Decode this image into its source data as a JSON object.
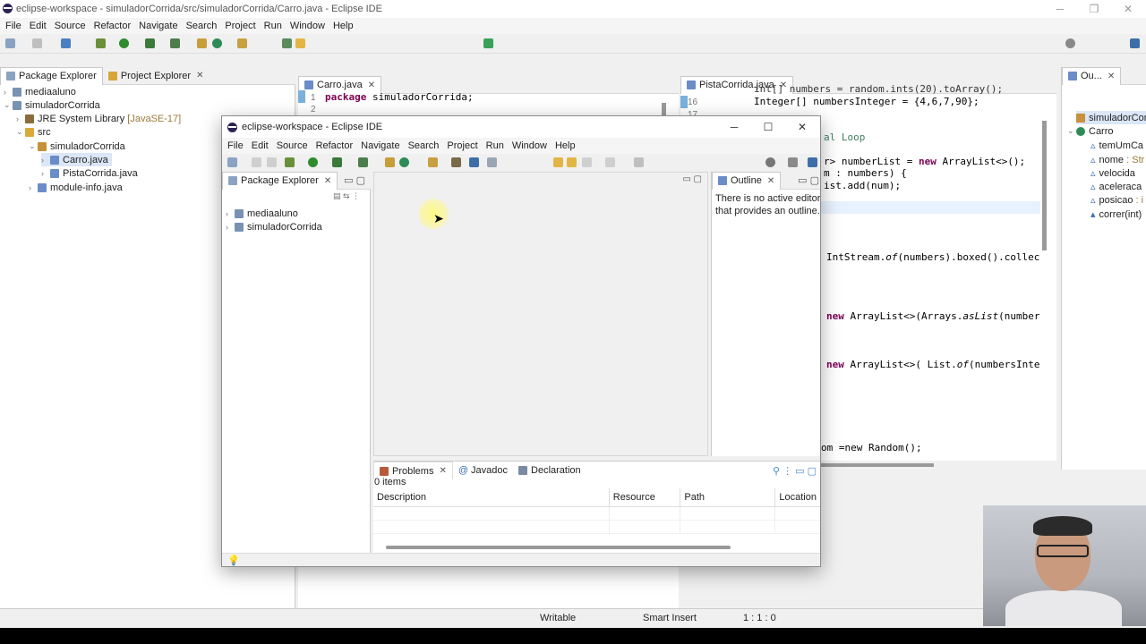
{
  "bg": {
    "title": "eclipse-workspace - simuladorCorrida/src/simuladorCorrida/Carro.java - Eclipse IDE",
    "menu": [
      "File",
      "Edit",
      "Source",
      "Refactor",
      "Navigate",
      "Search",
      "Project",
      "Run",
      "Window",
      "Help"
    ],
    "left_tabs": {
      "pkg": "Package Explorer",
      "proj": "Project Explorer"
    },
    "tree": {
      "r1": "mediaaluno",
      "r2": "simuladorCorrida",
      "r3": "JRE System Library",
      "r3b": "[JavaSE-17]",
      "r4": "src",
      "r5": "simuladorCorrida",
      "r6": "Carro.java",
      "r7": "PistaCorrida.java",
      "r8": "module-info.java"
    },
    "editor1": {
      "tab": "Carro.java",
      "l1_num": "1",
      "l1_kw": "package",
      "l1_rest": " simuladorCorrida;",
      "l2_num": "2"
    },
    "editor2": {
      "tab": "PistaCorrida.java",
      "l16_num": "16",
      "l15": "int[] numbers = random.ints(20).toArray();",
      "l16": "Integer[] numbersInteger = {4,6,7,90};",
      "l17_num": "17",
      "c1": "al Loop",
      "c2a": "r> numberList = ",
      "c2b": "new",
      "c2c": " ArrayList<>();",
      "c3": "m : numbers) {",
      "c4": "ist.add(num);",
      "c5a": "IntStream.",
      "c5b": "of",
      "c5c": "(numbers).boxed().collec",
      "c6a": "new",
      "c6b": " ArrayList<>(Arrays.",
      "c6c": "asList",
      "c6d": "(number",
      "c7a": "new",
      "c7b": " ArrayList<>( List.",
      "c7c": "of",
      "c7d": "(numbersInte",
      "c8": "om =new Random();"
    },
    "outline": {
      "tab": "Ou...",
      "r1": "simuladorCor",
      "r2": "Carro",
      "r3": "temUmCa",
      "r4": "nome",
      "r4b": ": Str",
      "r5": "velocida",
      "r6": "aceleraca",
      "r7": "posicao",
      "r7b": ": i",
      "r8": "correr(int)"
    },
    "status": {
      "writable": "Writable",
      "insert": "Smart Insert",
      "pos": "1 : 1 : 0"
    }
  },
  "fg": {
    "title": "eclipse-workspace - Eclipse IDE",
    "menu": [
      "File",
      "Edit",
      "Source",
      "Refactor",
      "Navigate",
      "Search",
      "Project",
      "Run",
      "Window",
      "Help"
    ],
    "pkg_tab": "Package Explorer",
    "tree": [
      "mediaaluno",
      "simuladorCorrida"
    ],
    "outline_tab": "Outline",
    "outline_msg1": "There is no active editor",
    "outline_msg2": "that provides an outline.",
    "problems": {
      "tab_problems": "Problems",
      "tab_javadoc": "Javadoc",
      "tab_declaration": "Declaration",
      "count": "0 items",
      "headers": [
        "Description",
        "Resource",
        "Path",
        "Location"
      ]
    }
  },
  "colors": {
    "keyword": "#7f0055",
    "comment": "#3f7f5f",
    "eclipse_purple": "#2c2255",
    "cursor_highlight": "#fff37a"
  }
}
